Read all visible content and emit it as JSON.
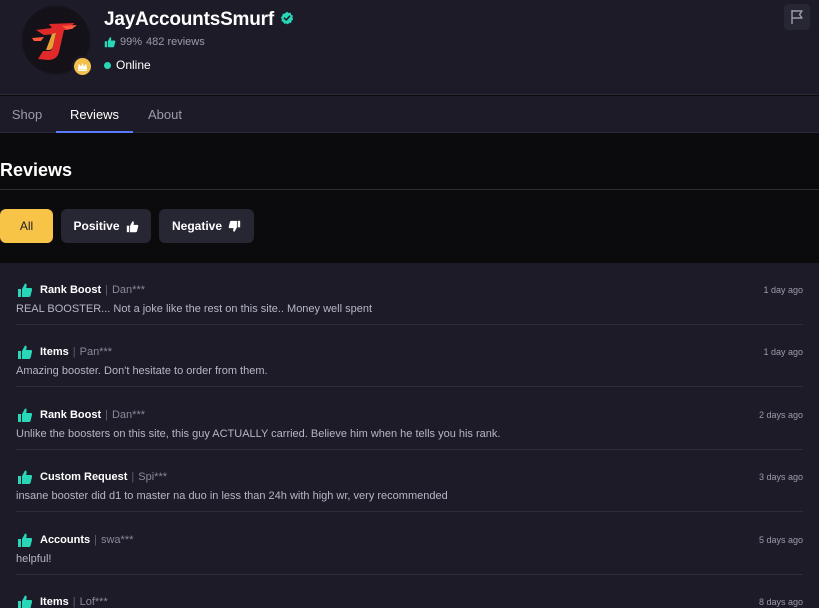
{
  "seller": {
    "name": "JayAccountsSmurf",
    "rating_percent": "99%",
    "reviews_count": "482 reviews",
    "status": "Online",
    "avatar_icon": "flame-j-logo",
    "badge_icon": "crown-icon"
  },
  "tabs": [
    {
      "label": "Shop",
      "active": false
    },
    {
      "label": "Reviews",
      "active": true
    },
    {
      "label": "About",
      "active": false
    }
  ],
  "reviews_section": {
    "title": "Reviews",
    "filters": {
      "all": "All",
      "positive": "Positive",
      "negative": "Negative"
    }
  },
  "reviews": [
    {
      "category": "Rank Boost",
      "user": "Dan***",
      "time": "1 day ago",
      "text": "REAL BOOSTER... Not a joke like the rest on this site.. Money well spent"
    },
    {
      "category": "Items",
      "user": "Pan***",
      "time": "1 day ago",
      "text": "Amazing booster. Don't hesitate to order from them."
    },
    {
      "category": "Rank Boost",
      "user": "Dan***",
      "time": "2 days ago",
      "text": "Unlike the boosters on this site, this guy ACTUALLY carried. Believe him when he tells you his rank."
    },
    {
      "category": "Custom Request",
      "user": "Spi***",
      "time": "3 days ago",
      "text": "insane booster did d1 to master na duo in less than 24h with high wr, very recommended"
    },
    {
      "category": "Accounts",
      "user": "swa***",
      "time": "5 days ago",
      "text": "helpful!"
    },
    {
      "category": "Items",
      "user": "Lof***",
      "time": "8 days ago",
      "text": ""
    }
  ],
  "colors": {
    "accent_yellow": "#f8c448",
    "positive_green": "#27d7b8",
    "tab_underline": "#5b7bff",
    "panel_bg": "#1c1b27"
  }
}
